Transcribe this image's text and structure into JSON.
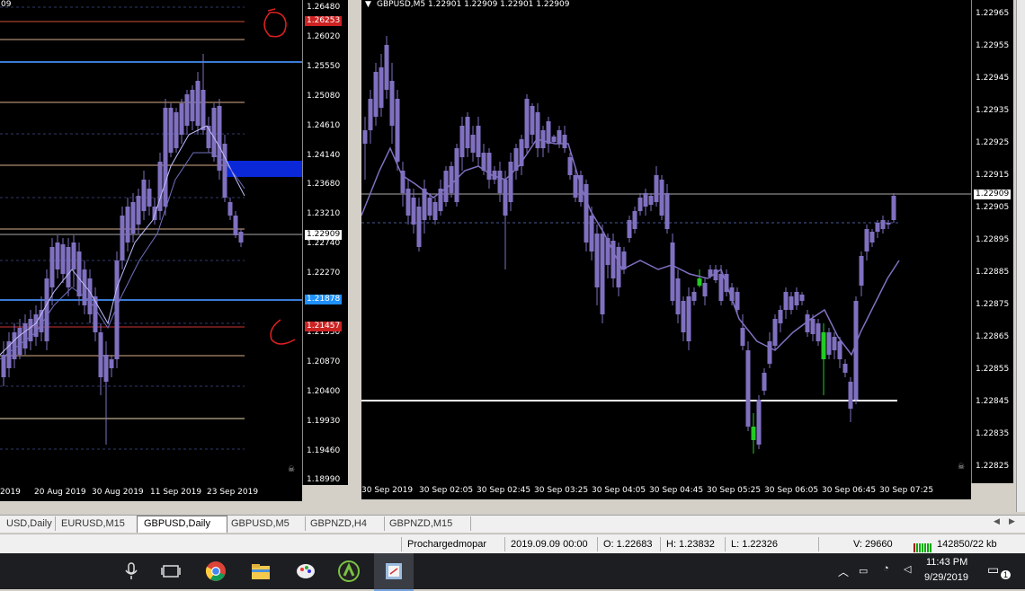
{
  "left_chart": {
    "price_labels": [
      "1.26480",
      "1.26020",
      "1.25550",
      "1.25080",
      "1.24610",
      "1.24140",
      "1.23680",
      "1.23210",
      "1.22740",
      "1.22270",
      "1.21800",
      "1.21330",
      "1.20870",
      "1.20400",
      "1.19930",
      "1.19460",
      "1.18990"
    ],
    "tag_top": "1.26253",
    "tag_current": "1.22909",
    "tag_blue": "1.21878",
    "tag_bottom": "1.21457",
    "time_labels": [
      "2019",
      "20 Aug 2019",
      "30 Aug 2019",
      "11 Sep 2019",
      "23 Sep 2019"
    ],
    "corner_text": "09",
    "up_color": "#8070c0",
    "line_color_blue": "#1e90ff",
    "tag_red": "#cc2222"
  },
  "right_chart": {
    "header": "GBPUSD,M5  1.22901 1.22909 1.22901 1.22909",
    "price_labels": [
      "1.22965",
      "1.22955",
      "1.22945",
      "1.22935",
      "1.22925",
      "1.22915",
      "1.22905",
      "1.22895",
      "1.22885",
      "1.22875",
      "1.22865",
      "1.22855",
      "1.22845",
      "1.22835",
      "1.22825"
    ],
    "tag_current": "1.22909",
    "time_labels": [
      "30 Sep 2019",
      "30 Sep 02:05",
      "30 Sep 02:45",
      "30 Sep 03:25",
      "30 Sep 04:05",
      "30 Sep 04:45",
      "30 Sep 05:25",
      "30 Sep 06:05",
      "30 Sep 06:45",
      "30 Sep 07:25"
    ]
  },
  "tabs": [
    "USD,Daily",
    "EURUSD,M15",
    "GBPUSD,Daily",
    "GBPUSD,M5",
    "GBPNZD,H4",
    "GBPNZD,M15"
  ],
  "active_tab": "GBPUSD,Daily",
  "status": {
    "profile": "Prochargedmopar",
    "datetime": "2019.09.09 00:00",
    "open": "O: 1.22683",
    "high": "H: 1.23832",
    "low": "L: 1.22326",
    "volume": "V: 29660",
    "traffic": "142850/22 kb"
  },
  "taskbar": {
    "time": "11:43 PM",
    "date": "9/29/2019",
    "notification_count": "1",
    "icons": [
      "microphone-icon",
      "task-view-icon",
      "chrome-icon",
      "file-explorer-icon",
      "paint-icon",
      "ninja-icon",
      "app-icon"
    ]
  }
}
